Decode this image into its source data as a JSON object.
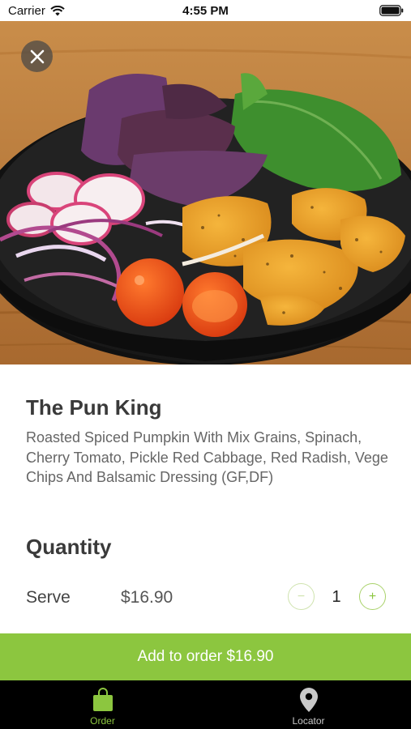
{
  "status_bar": {
    "carrier": "Carrier",
    "time": "4:55 PM"
  },
  "product": {
    "name": "The Pun King",
    "description": "Roasted Spiced Pumpkin With Mix Grains, Spinach, Cherry Tomato, Pickle Red Cabbage, Red Radish, Vege Chips And Balsamic Dressing (GF,DF)"
  },
  "quantity": {
    "heading": "Quantity",
    "serve_label": "Serve",
    "price": "$16.90",
    "value": "1",
    "minus_symbol": "−",
    "plus_symbol": "+"
  },
  "add_button": {
    "label": "Add to order $16.90"
  },
  "tab_bar": {
    "tabs": [
      {
        "label": "Order",
        "icon": "shopping-bag-icon",
        "active": true
      },
      {
        "label": "Locator",
        "icon": "location-pin-icon",
        "active": false
      }
    ]
  },
  "colors": {
    "accent": "#8cc63f",
    "tab_bar": "#000000",
    "text": "#3a3a3a"
  }
}
